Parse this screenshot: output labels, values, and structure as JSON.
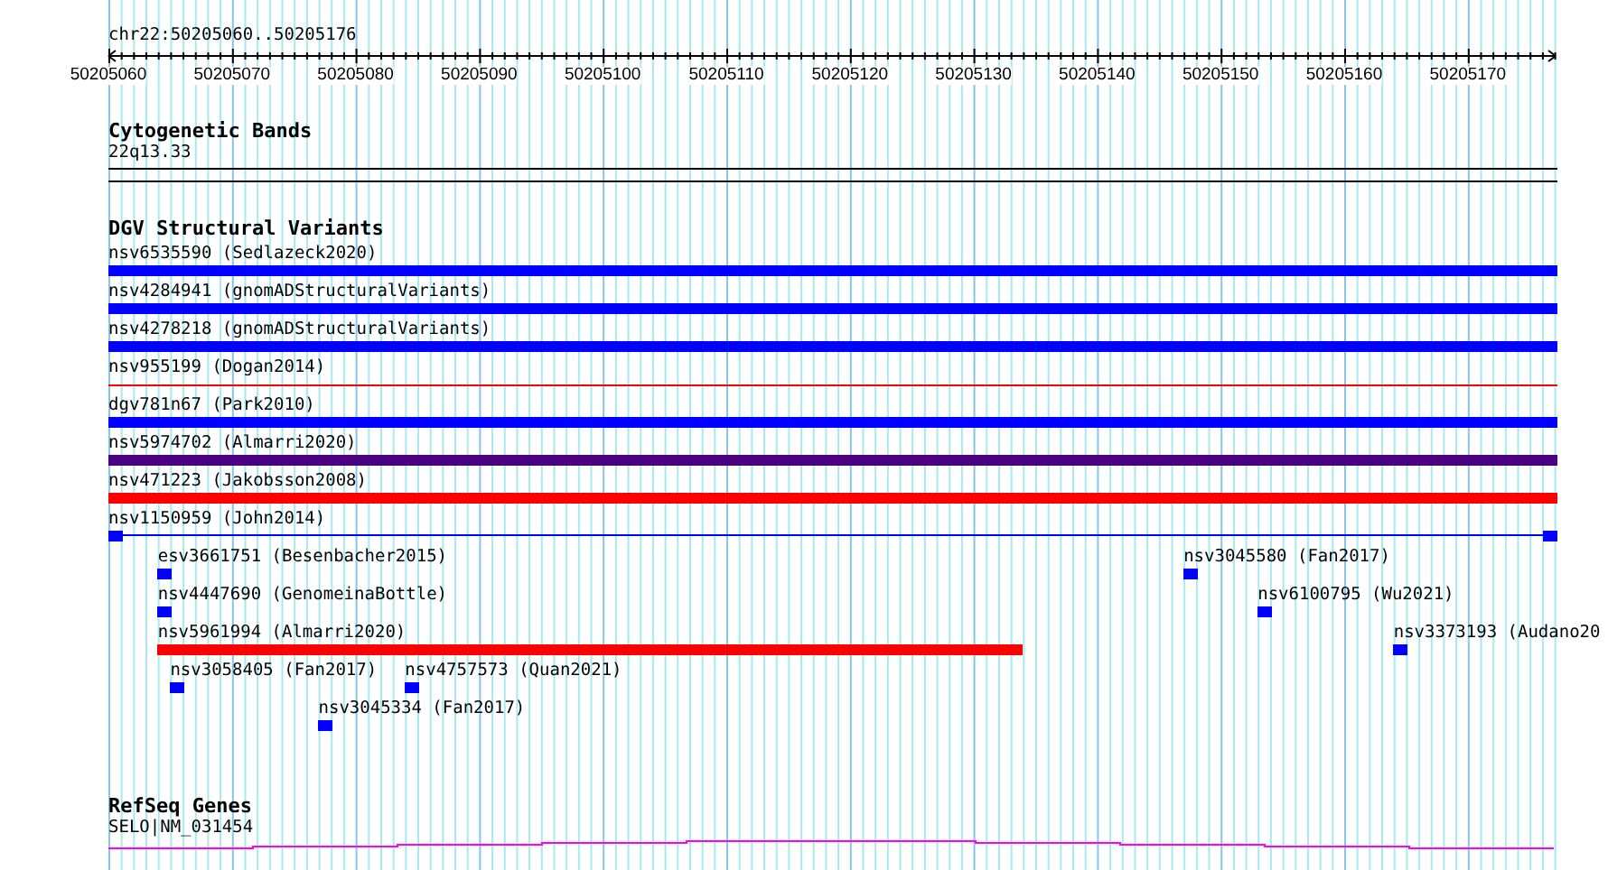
{
  "ruler": {
    "location": "chr22:50205060..50205176",
    "labels": [
      "50205060",
      "50205070",
      "50205080",
      "50205090",
      "50205100",
      "50205110",
      "50205120",
      "50205130",
      "50205140",
      "50205150",
      "50205160",
      "50205170"
    ]
  },
  "cytogenetic_bands": {
    "title": "Cytogenetic Bands",
    "band": "22q13.33"
  },
  "dgv_structural_variants": {
    "title": "DGV Structural Variants",
    "stacked": [
      {
        "label": "nsv6535590 (Sedlazeck2020)",
        "kind": "bar",
        "color": "#0000ff"
      },
      {
        "label": "nsv4284941 (gnomADStructuralVariants)",
        "kind": "bar",
        "color": "#0000ff"
      },
      {
        "label": "nsv4278218 (gnomADStructuralVariants)",
        "kind": "bar",
        "color": "#0000ff"
      },
      {
        "label": "nsv955199 (Dogan2014)",
        "kind": "line",
        "color": "#ff0000"
      },
      {
        "label": "dgv781n67 (Park2010)",
        "kind": "bar",
        "color": "#0000ff"
      },
      {
        "label": "nsv5974702 (Almarri2020)",
        "kind": "bar",
        "color": "#4b0082"
      },
      {
        "label": "nsv471223 (Jakobsson2008)",
        "kind": "bar",
        "color": "#ff0000"
      },
      {
        "label": "nsv1150959 (John2014)",
        "kind": "span",
        "color": "#0000ff"
      }
    ],
    "packed": [
      {
        "label": "esv3661751 (Besenbacher2015)",
        "color": "#0000ff"
      },
      {
        "label": "nsv4447690 (GenomeinaBottle)",
        "color": "#0000ff"
      },
      {
        "label": "nsv5961994 (Almarri2020)",
        "color": "#ff0000"
      },
      {
        "label": "nsv3058405 (Fan2017)",
        "color": "#0000ff"
      },
      {
        "label": "nsv4757573 (Quan2021)",
        "color": "#0000ff"
      },
      {
        "label": "nsv3045334 (Fan2017)",
        "color": "#0000ff"
      },
      {
        "label": "nsv3045580 (Fan2017)",
        "color": "#0000ff"
      },
      {
        "label": "nsv6100795 (Wu2021)",
        "color": "#0000ff"
      },
      {
        "label": "nsv3373193 (Audano20",
        "color": "#0000ff"
      }
    ]
  },
  "refseq_genes": {
    "title": "RefSeq Genes",
    "gene": "SELO|NM_031454",
    "color": "#ff00ff"
  }
}
